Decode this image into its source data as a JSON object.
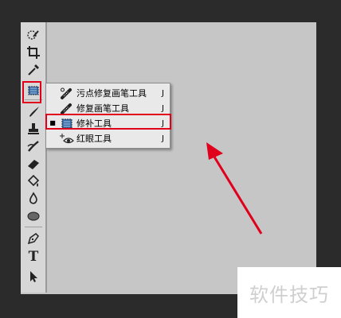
{
  "toolbar": {
    "tools": [
      {
        "icon": "quick-selection-icon"
      },
      {
        "icon": "crop-icon"
      },
      {
        "icon": "eyedropper-icon"
      },
      {
        "icon": "patch-tool-icon",
        "active": true
      },
      {
        "icon": "brush-icon"
      },
      {
        "icon": "clone-stamp-icon"
      },
      {
        "icon": "history-brush-icon"
      },
      {
        "icon": "eraser-icon"
      },
      {
        "icon": "paint-bucket-icon"
      },
      {
        "icon": "blur-icon"
      },
      {
        "icon": "dodge-icon"
      },
      {
        "icon": "pen-icon"
      },
      {
        "icon": "type-icon"
      },
      {
        "icon": "path-selection-icon"
      }
    ],
    "type_glyph": "T"
  },
  "flyout": {
    "items": [
      {
        "label": "污点修复画笔工具",
        "shortcut": "J",
        "icon": "spot-healing-brush-icon",
        "selected": false
      },
      {
        "label": "修复画笔工具",
        "shortcut": "J",
        "icon": "healing-brush-icon",
        "selected": false
      },
      {
        "label": "修补工具",
        "shortcut": "J",
        "icon": "patch-tool-icon",
        "selected": true
      },
      {
        "label": "红眼工具",
        "shortcut": "J",
        "icon": "red-eye-icon",
        "selected": false
      }
    ],
    "selected_marker": "■"
  },
  "watermark": {
    "text": "软件技巧"
  },
  "colors": {
    "highlight": "#e0001b",
    "canvas": "#c6c6c6",
    "background": "#2b2b2b"
  }
}
